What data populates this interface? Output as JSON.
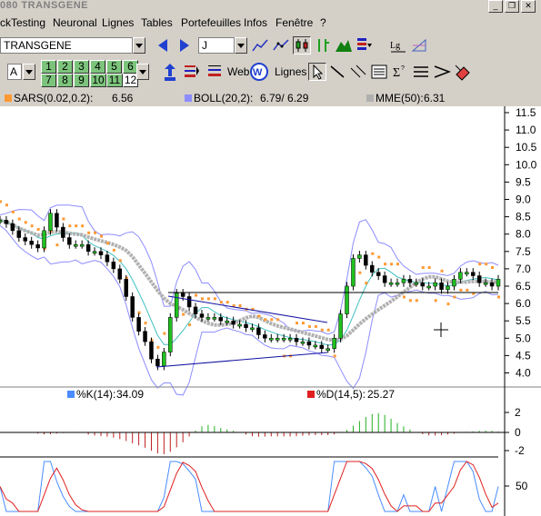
{
  "window": {
    "title": "080  TRANSGENE"
  },
  "menu": [
    "ckTesting",
    "Neuronal",
    "Lignes",
    "Tables",
    "Portefeuilles",
    "Infos",
    "Fenêtre",
    "?"
  ],
  "toolbar": {
    "symbol_value": "TRANSGENE",
    "period_value": "J",
    "web_label": "Web",
    "lignes_label": "Lignes",
    "letter_a": "A",
    "num_buttons": [
      "1",
      "2",
      "3",
      "4",
      "5",
      "6",
      "7",
      "8",
      "9",
      "10",
      "11",
      "12"
    ]
  },
  "indicators": {
    "sar": {
      "label": "SARS(0.02,0.2):",
      "value": "6.56",
      "color": "#ff9933"
    },
    "boll": {
      "label": "BOLL(20,2):",
      "value": "6.79/  6.29",
      "color": "#8c8cff"
    },
    "mme": {
      "label": "MME(50):",
      "value": "6.31",
      "color": "#b0b0b0"
    }
  },
  "oscillators": {
    "k": {
      "label": "%K(14):",
      "value": "34.09",
      "color": "#4a8cff"
    },
    "d": {
      "label": "%D(14,5):",
      "value": "25.27",
      "color": "#e02020"
    }
  },
  "chart_data": {
    "type": "line",
    "price_axis": [
      "11.5",
      "11.0",
      "10.5",
      "10.0",
      "9.5",
      "9.0",
      "8.5",
      "8.0",
      "7.5",
      "7.0",
      "6.5",
      "6.0",
      "5.5",
      "5.0",
      "4.5",
      "4.0"
    ],
    "close": [
      8.4,
      8.3,
      8.1,
      7.9,
      7.8,
      7.7,
      7.6,
      8.1,
      8.6,
      8.2,
      7.9,
      7.7,
      7.7,
      7.7,
      7.5,
      7.5,
      7.4,
      7.2,
      7.0,
      6.7,
      6.2,
      5.6,
      5.2,
      4.9,
      4.4,
      4.2,
      4.6,
      5.6,
      6.3,
      6.2,
      5.9,
      5.7,
      5.6,
      5.6,
      5.6,
      5.5,
      5.5,
      5.4,
      5.4,
      5.3,
      5.3,
      5.1,
      5.0,
      5.0,
      5.0,
      5.0,
      5.0,
      4.9,
      4.9,
      4.8,
      4.8,
      4.7,
      4.7,
      5.0,
      5.7,
      6.5,
      7.3,
      7.4,
      7.1,
      6.9,
      6.8,
      6.6,
      6.6,
      6.6,
      6.7,
      6.6,
      6.6,
      6.5,
      6.5,
      6.6,
      6.4,
      6.5,
      6.7,
      6.9,
      6.9,
      6.8,
      6.6,
      6.6,
      6.5,
      6.7
    ],
    "osc_axis_top": [
      "2",
      "0",
      "-2"
    ],
    "osc_axis_bottom": [
      "50"
    ]
  }
}
